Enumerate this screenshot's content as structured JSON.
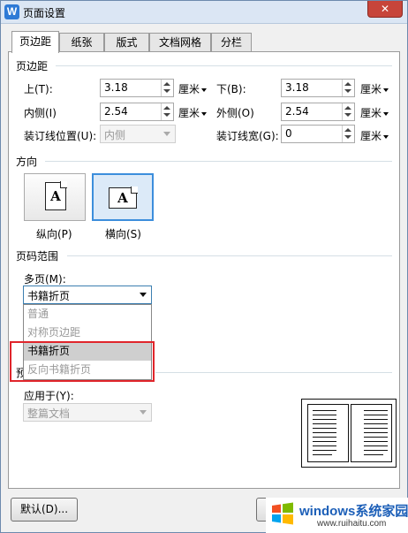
{
  "window": {
    "title": "页面设置",
    "app_icon": "W",
    "close_symbol": "✕"
  },
  "tabs": [
    {
      "label": "页边距",
      "active": true
    },
    {
      "label": "纸张",
      "active": false
    },
    {
      "label": "版式",
      "active": false
    },
    {
      "label": "文档网格",
      "active": false
    },
    {
      "label": "分栏",
      "active": false
    }
  ],
  "margins": {
    "group_title": "页边距",
    "top": {
      "label": "上(T):",
      "value": "3.18",
      "unit": "厘米"
    },
    "bottom": {
      "label": "下(B):",
      "value": "3.18",
      "unit": "厘米"
    },
    "inside": {
      "label": "内侧(I)",
      "value": "2.54",
      "unit": "厘米"
    },
    "outside": {
      "label": "外侧(O)",
      "value": "2.54",
      "unit": "厘米"
    },
    "gutter_position": {
      "label": "装订线位置(U):",
      "value": "内侧"
    },
    "gutter_width": {
      "label": "装订线宽(G):",
      "value": "0",
      "unit": "厘米"
    }
  },
  "orientation": {
    "group_title": "方向",
    "portrait": {
      "label": "纵向(P)",
      "icon_letter": "A"
    },
    "landscape": {
      "label": "横向(S)",
      "icon_letter": "A"
    },
    "selected": "landscape"
  },
  "pages": {
    "group_title": "页码范围",
    "multiple_label": "多页(M):",
    "selected": "书籍折页",
    "options": [
      "普通",
      "对称页边距",
      "书籍折页",
      "反向书籍折页"
    ],
    "highlighted": "书籍折页"
  },
  "preview": {
    "group_title_partial": "预",
    "apply_to_label": "应用于(Y):",
    "apply_to_value": "整篇文档"
  },
  "buttons": {
    "default_label": "默认(D)..."
  },
  "watermark": {
    "brand": "windows系统家园",
    "url": "www.ruihaitu.com"
  },
  "colors": {
    "highlight_box": "#e0252b",
    "selected_border": "#3c8edc"
  }
}
